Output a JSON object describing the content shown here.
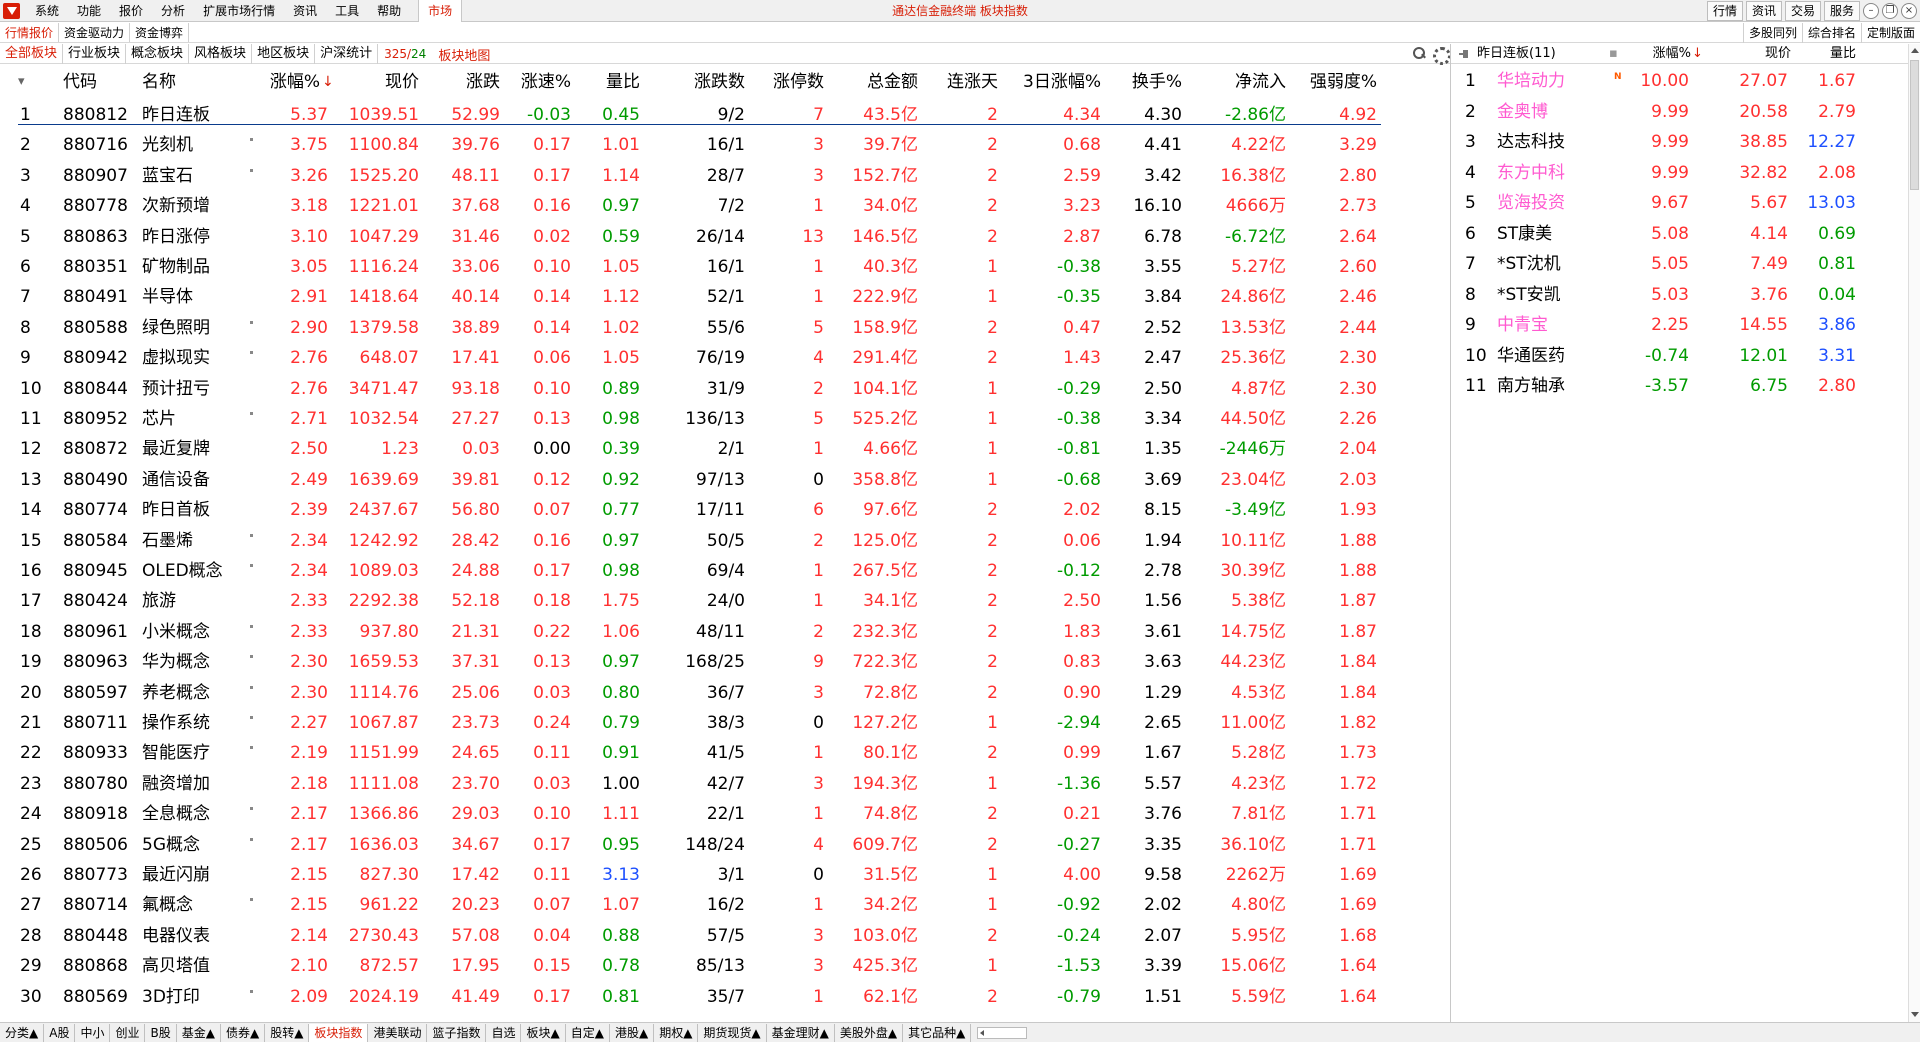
{
  "menubar": {
    "items": [
      "系统",
      "功能",
      "报价",
      "分析",
      "扩展市场行情",
      "资讯",
      "工具",
      "帮助"
    ],
    "market_tab": "市场",
    "title": "通达信金融终端  板块指数",
    "right_buttons": [
      "行情",
      "资讯",
      "交易",
      "服务"
    ]
  },
  "nav1": {
    "tabs": [
      "行情报价",
      "资金驱动力",
      "资金博弈"
    ],
    "right_tabs": [
      "多股同列",
      "综合排名",
      "定制版面"
    ]
  },
  "nav2": {
    "tabs": [
      "全部板块",
      "行业板块",
      "概念板块",
      "风格板块",
      "地区板块",
      "沪深统计"
    ],
    "count_a": "325",
    "count_sep": "/",
    "count_b": "24",
    "map": "板块地图"
  },
  "table": {
    "headers": [
      "代码",
      "名称",
      "涨幅%",
      "现价",
      "涨跌",
      "涨速%",
      "量比",
      "涨跌数",
      "涨停数",
      "总金额",
      "连涨天",
      "3日涨幅%",
      "换手%",
      "净流入",
      "强弱度%"
    ],
    "sort_arrow": "↓",
    "rows": [
      {
        "i": "1",
        "code": "880812",
        "name": "昨日连板",
        "chg": "5.37",
        "price": "1039.51",
        "diff": "52.99",
        "spd": "-0.03",
        "vr": "0.45",
        "ud": "9/2",
        "zt": "7",
        "amt": "43.5亿",
        "lz": "2",
        "d3": "4.34",
        "hs": "4.30",
        "net": "-2.86亿",
        "qr": "4.92",
        "mark": false
      },
      {
        "i": "2",
        "code": "880716",
        "name": "光刻机",
        "chg": "3.75",
        "price": "1100.84",
        "diff": "39.76",
        "spd": "0.17",
        "vr": "1.01",
        "ud": "16/1",
        "zt": "3",
        "amt": "39.7亿",
        "lz": "2",
        "d3": "0.68",
        "hs": "4.41",
        "net": "4.22亿",
        "qr": "3.29",
        "mark": true
      },
      {
        "i": "3",
        "code": "880907",
        "name": "蓝宝石",
        "chg": "3.26",
        "price": "1525.20",
        "diff": "48.11",
        "spd": "0.17",
        "vr": "1.14",
        "ud": "28/7",
        "zt": "3",
        "amt": "152.7亿",
        "lz": "2",
        "d3": "2.59",
        "hs": "3.42",
        "net": "16.38亿",
        "qr": "2.80",
        "mark": true
      },
      {
        "i": "4",
        "code": "880778",
        "name": "次新预增",
        "chg": "3.18",
        "price": "1221.01",
        "diff": "37.68",
        "spd": "0.16",
        "vr": "0.97",
        "ud": "7/2",
        "zt": "1",
        "amt": "34.0亿",
        "lz": "2",
        "d3": "3.23",
        "hs": "16.10",
        "net": "4666万",
        "qr": "2.73",
        "mark": false
      },
      {
        "i": "5",
        "code": "880863",
        "name": "昨日涨停",
        "chg": "3.10",
        "price": "1047.29",
        "diff": "31.46",
        "spd": "0.02",
        "vr": "0.59",
        "ud": "26/14",
        "zt": "13",
        "amt": "146.5亿",
        "lz": "2",
        "d3": "2.87",
        "hs": "6.78",
        "net": "-6.72亿",
        "qr": "2.64",
        "mark": false
      },
      {
        "i": "6",
        "code": "880351",
        "name": "矿物制品",
        "chg": "3.05",
        "price": "1116.24",
        "diff": "33.06",
        "spd": "0.10",
        "vr": "1.05",
        "ud": "16/1",
        "zt": "1",
        "amt": "40.3亿",
        "lz": "1",
        "d3": "-0.38",
        "hs": "3.55",
        "net": "5.27亿",
        "qr": "2.60",
        "mark": false
      },
      {
        "i": "7",
        "code": "880491",
        "name": "半导体",
        "chg": "2.91",
        "price": "1418.64",
        "diff": "40.14",
        "spd": "0.14",
        "vr": "1.12",
        "ud": "52/1",
        "zt": "1",
        "amt": "222.9亿",
        "lz": "1",
        "d3": "-0.35",
        "hs": "3.84",
        "net": "24.86亿",
        "qr": "2.46",
        "mark": false
      },
      {
        "i": "8",
        "code": "880588",
        "name": "绿色照明",
        "chg": "2.90",
        "price": "1379.58",
        "diff": "38.89",
        "spd": "0.14",
        "vr": "1.02",
        "ud": "55/6",
        "zt": "5",
        "amt": "158.9亿",
        "lz": "2",
        "d3": "0.47",
        "hs": "2.52",
        "net": "13.53亿",
        "qr": "2.44",
        "mark": true
      },
      {
        "i": "9",
        "code": "880942",
        "name": "虚拟现实",
        "chg": "2.76",
        "price": "648.07",
        "diff": "17.41",
        "spd": "0.06",
        "vr": "1.05",
        "ud": "76/19",
        "zt": "4",
        "amt": "291.4亿",
        "lz": "2",
        "d3": "1.43",
        "hs": "2.47",
        "net": "25.36亿",
        "qr": "2.30",
        "mark": true
      },
      {
        "i": "10",
        "code": "880844",
        "name": "预计扭亏",
        "chg": "2.76",
        "price": "3471.47",
        "diff": "93.18",
        "spd": "0.10",
        "vr": "0.89",
        "ud": "31/9",
        "zt": "2",
        "amt": "104.1亿",
        "lz": "1",
        "d3": "-0.29",
        "hs": "2.50",
        "net": "4.87亿",
        "qr": "2.30",
        "mark": false
      },
      {
        "i": "11",
        "code": "880952",
        "name": "芯片",
        "chg": "2.71",
        "price": "1032.54",
        "diff": "27.27",
        "spd": "0.13",
        "vr": "0.98",
        "ud": "136/13",
        "zt": "5",
        "amt": "525.2亿",
        "lz": "1",
        "d3": "-0.38",
        "hs": "3.34",
        "net": "44.50亿",
        "qr": "2.26",
        "mark": true
      },
      {
        "i": "12",
        "code": "880872",
        "name": "最近复牌",
        "chg": "2.50",
        "price": "1.23",
        "diff": "0.03",
        "spd": "0.00",
        "vr": "0.39",
        "ud": "2/1",
        "zt": "1",
        "amt": "4.66亿",
        "lz": "1",
        "d3": "-0.81",
        "hs": "1.35",
        "net": "-2446万",
        "qr": "2.04",
        "mark": false
      },
      {
        "i": "13",
        "code": "880490",
        "name": "通信设备",
        "chg": "2.49",
        "price": "1639.69",
        "diff": "39.81",
        "spd": "0.12",
        "vr": "0.92",
        "ud": "97/13",
        "zt": "0",
        "amt": "358.8亿",
        "lz": "1",
        "d3": "-0.68",
        "hs": "3.69",
        "net": "23.04亿",
        "qr": "2.03",
        "mark": false
      },
      {
        "i": "14",
        "code": "880774",
        "name": "昨日首板",
        "chg": "2.39",
        "price": "2437.67",
        "diff": "56.80",
        "spd": "0.07",
        "vr": "0.77",
        "ud": "17/11",
        "zt": "6",
        "amt": "97.6亿",
        "lz": "2",
        "d3": "2.02",
        "hs": "8.15",
        "net": "-3.49亿",
        "qr": "1.93",
        "mark": false
      },
      {
        "i": "15",
        "code": "880584",
        "name": "石墨烯",
        "chg": "2.34",
        "price": "1242.92",
        "diff": "28.42",
        "spd": "0.16",
        "vr": "0.97",
        "ud": "50/5",
        "zt": "2",
        "amt": "125.0亿",
        "lz": "2",
        "d3": "0.06",
        "hs": "1.94",
        "net": "10.11亿",
        "qr": "1.88",
        "mark": true
      },
      {
        "i": "16",
        "code": "880945",
        "name": "OLED概念",
        "chg": "2.34",
        "price": "1089.03",
        "diff": "24.88",
        "spd": "0.17",
        "vr": "0.98",
        "ud": "69/4",
        "zt": "1",
        "amt": "267.5亿",
        "lz": "2",
        "d3": "-0.12",
        "hs": "2.78",
        "net": "30.39亿",
        "qr": "1.88",
        "mark": true
      },
      {
        "i": "17",
        "code": "880424",
        "name": "旅游",
        "chg": "2.33",
        "price": "2292.38",
        "diff": "52.18",
        "spd": "0.18",
        "vr": "1.75",
        "ud": "24/0",
        "zt": "1",
        "amt": "34.1亿",
        "lz": "2",
        "d3": "2.50",
        "hs": "1.56",
        "net": "5.38亿",
        "qr": "1.87",
        "mark": false
      },
      {
        "i": "18",
        "code": "880961",
        "name": "小米概念",
        "chg": "2.33",
        "price": "937.80",
        "diff": "21.31",
        "spd": "0.22",
        "vr": "1.06",
        "ud": "48/11",
        "zt": "2",
        "amt": "232.3亿",
        "lz": "2",
        "d3": "1.83",
        "hs": "3.61",
        "net": "14.75亿",
        "qr": "1.87",
        "mark": true
      },
      {
        "i": "19",
        "code": "880963",
        "name": "华为概念",
        "chg": "2.30",
        "price": "1659.53",
        "diff": "37.31",
        "spd": "0.13",
        "vr": "0.97",
        "ud": "168/25",
        "zt": "9",
        "amt": "722.3亿",
        "lz": "2",
        "d3": "0.83",
        "hs": "3.63",
        "net": "44.23亿",
        "qr": "1.84",
        "mark": true
      },
      {
        "i": "20",
        "code": "880597",
        "name": "养老概念",
        "chg": "2.30",
        "price": "1114.76",
        "diff": "25.06",
        "spd": "0.03",
        "vr": "0.80",
        "ud": "36/7",
        "zt": "3",
        "amt": "72.8亿",
        "lz": "2",
        "d3": "0.90",
        "hs": "1.29",
        "net": "4.53亿",
        "qr": "1.84",
        "mark": true
      },
      {
        "i": "21",
        "code": "880711",
        "name": "操作系统",
        "chg": "2.27",
        "price": "1067.87",
        "diff": "23.73",
        "spd": "0.24",
        "vr": "0.79",
        "ud": "38/3",
        "zt": "0",
        "amt": "127.2亿",
        "lz": "1",
        "d3": "-2.94",
        "hs": "2.65",
        "net": "11.00亿",
        "qr": "1.82",
        "mark": true
      },
      {
        "i": "22",
        "code": "880933",
        "name": "智能医疗",
        "chg": "2.19",
        "price": "1151.99",
        "diff": "24.65",
        "spd": "0.11",
        "vr": "0.91",
        "ud": "41/5",
        "zt": "1",
        "amt": "80.1亿",
        "lz": "2",
        "d3": "0.99",
        "hs": "1.67",
        "net": "5.28亿",
        "qr": "1.73",
        "mark": true
      },
      {
        "i": "23",
        "code": "880780",
        "name": "融资增加",
        "chg": "2.18",
        "price": "1111.08",
        "diff": "23.70",
        "spd": "0.03",
        "vr": "1.00",
        "ud": "42/7",
        "zt": "3",
        "amt": "194.3亿",
        "lz": "1",
        "d3": "-1.36",
        "hs": "5.57",
        "net": "4.23亿",
        "qr": "1.72",
        "mark": false
      },
      {
        "i": "24",
        "code": "880918",
        "name": "全息概念",
        "chg": "2.17",
        "price": "1366.86",
        "diff": "29.03",
        "spd": "0.10",
        "vr": "1.11",
        "ud": "22/1",
        "zt": "1",
        "amt": "74.8亿",
        "lz": "2",
        "d3": "0.21",
        "hs": "3.76",
        "net": "7.81亿",
        "qr": "1.71",
        "mark": true
      },
      {
        "i": "25",
        "code": "880506",
        "name": "5G概念",
        "chg": "2.17",
        "price": "1636.03",
        "diff": "34.67",
        "spd": "0.17",
        "vr": "0.95",
        "ud": "148/24",
        "zt": "4",
        "amt": "609.7亿",
        "lz": "2",
        "d3": "-0.27",
        "hs": "3.35",
        "net": "36.10亿",
        "qr": "1.71",
        "mark": true
      },
      {
        "i": "26",
        "code": "880773",
        "name": "最近闪崩",
        "chg": "2.15",
        "price": "827.30",
        "diff": "17.42",
        "spd": "0.11",
        "vr": "3.13",
        "ud": "3/1",
        "zt": "0",
        "amt": "31.5亿",
        "lz": "1",
        "d3": "4.00",
        "hs": "9.58",
        "net": "2262万",
        "qr": "1.69",
        "mark": false
      },
      {
        "i": "27",
        "code": "880714",
        "name": "氟概念",
        "chg": "2.15",
        "price": "961.22",
        "diff": "20.23",
        "spd": "0.07",
        "vr": "1.07",
        "ud": "16/2",
        "zt": "1",
        "amt": "34.2亿",
        "lz": "1",
        "d3": "-0.92",
        "hs": "2.02",
        "net": "4.80亿",
        "qr": "1.69",
        "mark": true
      },
      {
        "i": "28",
        "code": "880448",
        "name": "电器仪表",
        "chg": "2.14",
        "price": "2730.43",
        "diff": "57.08",
        "spd": "0.04",
        "vr": "0.88",
        "ud": "57/5",
        "zt": "3",
        "amt": "103.0亿",
        "lz": "2",
        "d3": "-0.24",
        "hs": "2.07",
        "net": "5.95亿",
        "qr": "1.68",
        "mark": false
      },
      {
        "i": "29",
        "code": "880868",
        "name": "高贝塔值",
        "chg": "2.10",
        "price": "872.57",
        "diff": "17.95",
        "spd": "0.15",
        "vr": "0.78",
        "ud": "85/13",
        "zt": "3",
        "amt": "425.3亿",
        "lz": "1",
        "d3": "-1.53",
        "hs": "3.39",
        "net": "15.06亿",
        "qr": "1.64",
        "mark": false
      },
      {
        "i": "30",
        "code": "880569",
        "name": "3D打印",
        "chg": "2.09",
        "price": "2024.19",
        "diff": "41.49",
        "spd": "0.17",
        "vr": "0.81",
        "ud": "35/7",
        "zt": "1",
        "amt": "62.1亿",
        "lz": "2",
        "d3": "-0.79",
        "hs": "1.51",
        "net": "5.59亿",
        "qr": "1.64",
        "mark": true
      }
    ]
  },
  "side": {
    "title": "昨日连板(11)",
    "headers": [
      "涨幅%",
      "现价",
      "量比"
    ],
    "sort_arrow": "↓",
    "badge": "N",
    "rows": [
      {
        "i": "1",
        "name": "华培动力",
        "chg": "10.00",
        "price": "27.07",
        "vr": "1.67",
        "name_color": "pink",
        "vr_color": "red",
        "badge": true
      },
      {
        "i": "2",
        "name": "金奥博",
        "chg": "9.99",
        "price": "20.58",
        "vr": "2.79",
        "name_color": "pink",
        "vr_color": "red",
        "badge": false
      },
      {
        "i": "3",
        "name": "达志科技",
        "chg": "9.99",
        "price": "38.85",
        "vr": "12.27",
        "name_color": "black",
        "vr_color": "blue",
        "badge": false
      },
      {
        "i": "4",
        "name": "东方中科",
        "chg": "9.99",
        "price": "32.82",
        "vr": "2.08",
        "name_color": "pink",
        "vr_color": "red",
        "badge": false
      },
      {
        "i": "5",
        "name": "览海投资",
        "chg": "9.67",
        "price": "5.67",
        "vr": "13.03",
        "name_color": "pink",
        "vr_color": "blue",
        "badge": false
      },
      {
        "i": "6",
        "name": "ST康美",
        "chg": "5.08",
        "price": "4.14",
        "vr": "0.69",
        "name_color": "black",
        "vr_color": "green",
        "badge": false
      },
      {
        "i": "7",
        "name": "*ST沈机",
        "chg": "5.05",
        "price": "7.49",
        "vr": "0.81",
        "name_color": "black",
        "vr_color": "green",
        "badge": false
      },
      {
        "i": "8",
        "name": "*ST安凯",
        "chg": "5.03",
        "price": "3.76",
        "vr": "0.04",
        "name_color": "black",
        "vr_color": "green",
        "badge": false
      },
      {
        "i": "9",
        "name": "中青宝",
        "chg": "2.25",
        "price": "14.55",
        "vr": "3.86",
        "name_color": "pink",
        "vr_color": "blue",
        "badge": false
      },
      {
        "i": "10",
        "name": "华通医药",
        "chg": "-0.74",
        "price": "12.01",
        "vr": "3.31",
        "name_color": "black",
        "vr_color": "blue",
        "badge": false
      },
      {
        "i": "11",
        "name": "南方轴承",
        "chg": "-3.57",
        "price": "6.75",
        "vr": "2.80",
        "name_color": "black",
        "vr_color": "red",
        "badge": false
      }
    ]
  },
  "bottom_tabs": [
    "分类▲",
    "A股",
    "中小",
    "创业",
    "B股",
    "基金▲",
    "债券▲",
    "股转▲",
    "板块指数",
    "港美联动",
    "篮子指数",
    "自选",
    "板块▲",
    "自定▲",
    "港股▲",
    "期权▲",
    "期货现货▲",
    "基金理财▲",
    "美股外盘▲",
    "其它品种▲"
  ],
  "bottom_active": 8,
  "colors": {
    "up": "#ff3030",
    "down": "#009b00",
    "accent": "#d81e06",
    "blue": "#1e50ff",
    "pink": "#ff5ad0"
  }
}
